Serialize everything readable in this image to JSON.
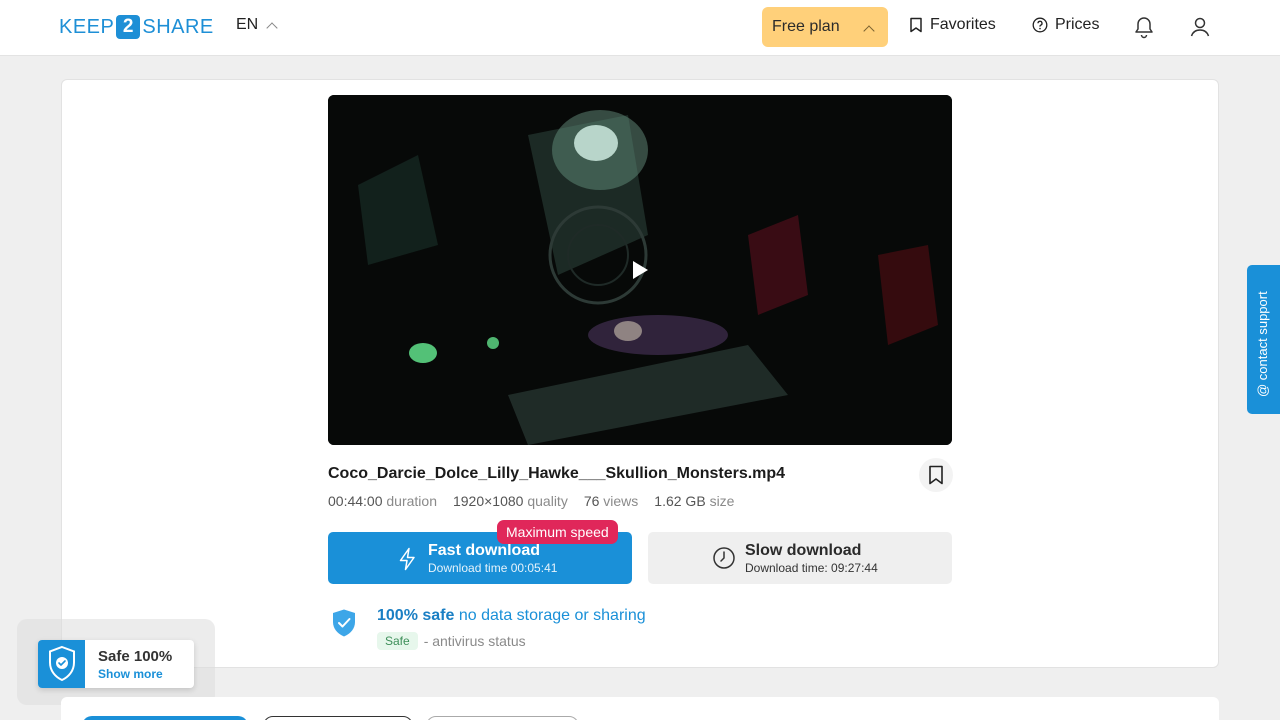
{
  "header": {
    "logo_left": "KEEP",
    "logo_num": "2",
    "logo_right": "SHARE",
    "lang": "EN",
    "plan": "Free plan",
    "favorites": "Favorites",
    "prices": "Prices"
  },
  "file": {
    "name": "Coco_Darcie_Dolce_Lilly_Hawke___Skullion_Monsters.mp4",
    "duration": "00:44:00",
    "duration_label": "duration",
    "quality": "1920×1080",
    "quality_label": "quality",
    "views": "76",
    "views_label": "views",
    "size": "1.62 GB",
    "size_label": "size"
  },
  "download": {
    "badge": "Maximum speed",
    "fast_title": "Fast download",
    "fast_time": "Download time 00:05:41",
    "slow_title": "Slow download",
    "slow_time": "Download time: 09:27:44"
  },
  "safety": {
    "bold": "100% safe",
    "rest": "no data storage or sharing",
    "status_pill": "Safe",
    "status_text": "- antivirus status"
  },
  "support": {
    "label": "@ contact support"
  },
  "widget": {
    "title": "Safe 100%",
    "link": "Show more"
  },
  "colors": {
    "accent": "#1a90d8",
    "plan": "#ffd07a",
    "badge": "#e0275a"
  }
}
